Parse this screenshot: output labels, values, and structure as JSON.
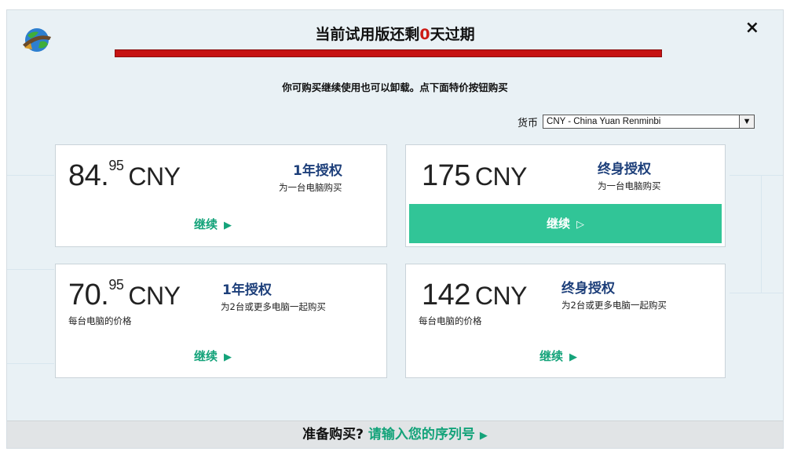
{
  "window": {
    "title_prefix": "当前试用版还剩",
    "days_left": "0",
    "title_suffix": "天过期",
    "close_label": "×",
    "subtitle": "你可购买继续使用也可以卸载。点下面特价按钮购买"
  },
  "currency": {
    "label": "货币",
    "selected": "CNY - China Yuan Renminbi"
  },
  "cards": [
    {
      "price_int": "84.",
      "price_dec": "95",
      "currency": "CNY",
      "license": "1年授权",
      "desc": "为一台电脑购买",
      "per": "",
      "continue": "继续"
    },
    {
      "price_int": "175",
      "price_dec": "",
      "currency": "CNY",
      "license": "终身授权",
      "desc": "为一台电脑购买",
      "per": "",
      "continue": "继续"
    },
    {
      "price_int": "70.",
      "price_dec": "95",
      "currency": "CNY",
      "license": "1年授权",
      "desc": "为2台或更多电脑一起购买",
      "per": "每台电脑的价格",
      "continue": "继续"
    },
    {
      "price_int": "142",
      "price_dec": "",
      "currency": "CNY",
      "license": "终身授权",
      "desc": "为2台或更多电脑一起购买",
      "per": "每台电脑的价格",
      "continue": "继续"
    }
  ],
  "footer": {
    "question": "准备购买?",
    "link": "请输入您的序列号"
  },
  "colors": {
    "progress": "#c61313",
    "accent": "#14a37a",
    "highlight_button": "#31c597",
    "license_title": "#1d3f7a",
    "days": "#cc1b16"
  },
  "icons": {
    "logo": "idm-globe-icon",
    "close": "close-icon",
    "dropdown": "chevron-down-icon",
    "continue": "play-triangle-icon"
  }
}
